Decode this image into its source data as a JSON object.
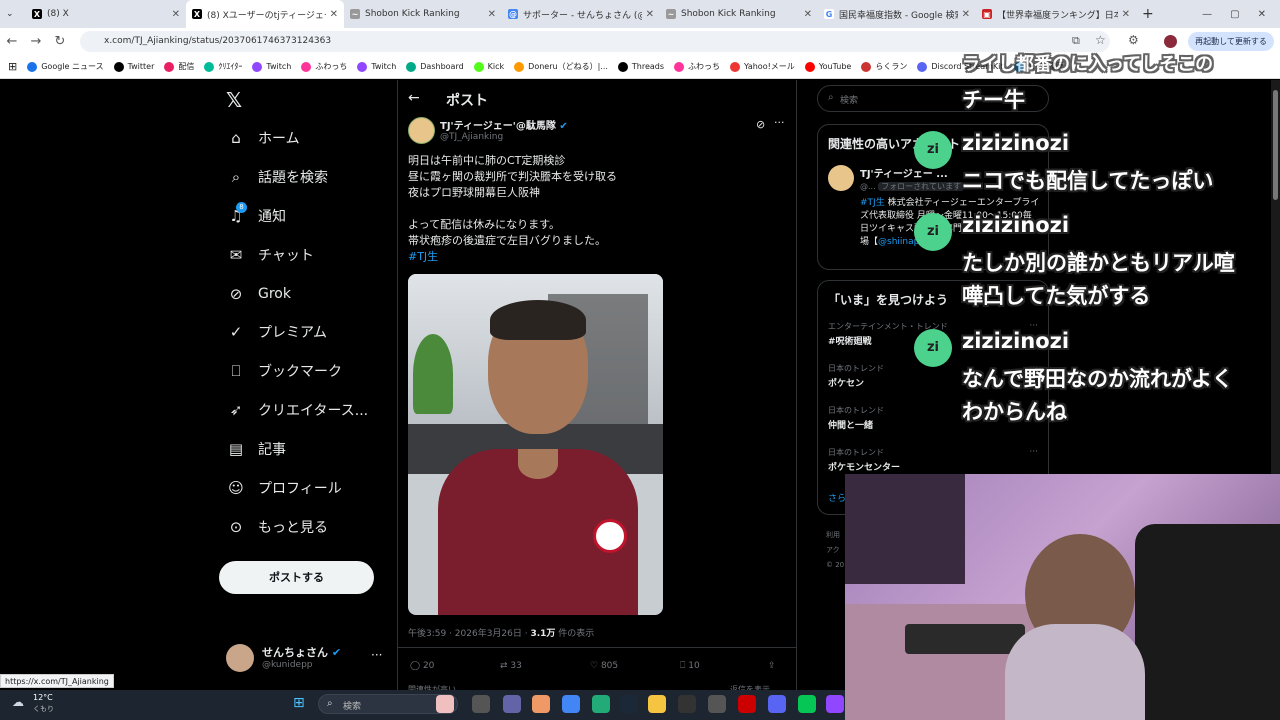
{
  "browser": {
    "tabs": [
      {
        "title": "(8) X",
        "fav": "X"
      },
      {
        "title": "(8) Xユーザーのtjティージェー'@駄馬",
        "fav": "X",
        "active": true
      },
      {
        "title": "Shobon Kick Ranking",
        "fav": "~"
      },
      {
        "title": "サポーター - せんちょさん (@kunide",
        "fav": "@"
      },
      {
        "title": "Shobon Kick Ranking",
        "fav": "~"
      },
      {
        "title": "国民幸福度指数 - Google 検索",
        "fav": "G"
      },
      {
        "title": "【世界幸福度ランキング】日本の幸",
        "fav": "▣"
      }
    ],
    "new_tab": "+",
    "url": "x.com/TJ_Ajianking/status/2037061746373124363",
    "resume_button": "再起動して更新する",
    "bookmarks": [
      "Google ニュース",
      "Twitter",
      "配信",
      "ｸﾘｴｲﾀｰ",
      "Twitch",
      "ふわっち",
      "Twitch",
      "Dashboard",
      "Kick",
      "Doneru（どねる）|...",
      "Threads",
      "ふわっち",
      "Yahoo!メール",
      "YouTube",
      "らくラン",
      "Discord StreamKit",
      "ﾂｲｯﾀｰ履歴"
    ]
  },
  "x": {
    "nav": [
      {
        "label": "ホーム",
        "icon": "home-icon"
      },
      {
        "label": "話題を検索",
        "icon": "search-icon"
      },
      {
        "label": "通知",
        "icon": "bell-icon",
        "badge": "8"
      },
      {
        "label": "チャット",
        "icon": "mail-icon"
      },
      {
        "label": "Grok",
        "icon": "grok-icon"
      },
      {
        "label": "プレミアム",
        "icon": "verified-icon"
      },
      {
        "label": "ブックマーク",
        "icon": "bookmark-icon"
      },
      {
        "label": "クリエイタース...",
        "icon": "rocket-icon"
      },
      {
        "label": "記事",
        "icon": "article-icon"
      },
      {
        "label": "プロフィール",
        "icon": "person-icon"
      },
      {
        "label": "もっと見る",
        "icon": "more-icon"
      }
    ],
    "post_button": "ポストする",
    "account": {
      "name": "せんちょさん",
      "handle": "@kunidepp"
    },
    "header_title": "ポスト",
    "post": {
      "author": "TJ'ティージェー'@駄馬隊",
      "handle": "@TJ_Ajianking",
      "lines": [
        "明日は午前中に肺のCT定期検診",
        "昼に霞ヶ関の裁判所で判決謄本を受け取る",
        "夜はプロ野球開幕巨人阪神",
        "",
        "よって配信は休みになります。",
        "帯状疱疹の後遺症で左目バグりました。"
      ],
      "hashtag": "#TJ生",
      "timestamp": "午後3:59 · 2026年3月26日 · ",
      "views_value": "3.1万",
      "views_label": " 件の表示",
      "replies": "20",
      "reposts": "33",
      "likes": "805",
      "bookmarks": "10",
      "below1": "関連性が高い",
      "below2": "返信を表示"
    },
    "search_placeholder": "検索",
    "related": {
      "title": "関連性の高いアカウント",
      "name": "TJ'ティージェー ...",
      "handle": "@...",
      "follows_you": "フォローされています",
      "bio_tag": "#TJ生",
      "bio": "株式会社ティージェーエンタープライズ代表取締役 月曜〜金曜11:00〜15:00毎日ツイキャス配信 カ専門店【",
      "bio_link": "@",
      "bio_end": "osu】 野球場【",
      "bio_handle": "@shiinapro",
      "bio_close": "】"
    },
    "trends": {
      "title": "「いま」を見つけよう",
      "items": [
        {
          "cat": "エンターテインメント・トレンド",
          "name": "#呪術廻戦"
        },
        {
          "cat": "日本のトレンド",
          "name": "ポケセン"
        },
        {
          "cat": "日本のトレンド",
          "name": "仲間と一緒"
        },
        {
          "cat": "日本のトレンド",
          "name": "ポケモンセンター"
        }
      ],
      "more": "さら"
    },
    "footer": [
      "利用",
      "アク",
      "© 20"
    ]
  },
  "status_url": "https://x.com/TJ_Ajianking",
  "chat": {
    "top_partial": "ライし都番のに入ってしそこの",
    "top_line2": "チー牛",
    "messages": [
      {
        "av": "zi",
        "user": "zizizinozi",
        "text": [
          "ニコでも配信してたっぽい"
        ]
      },
      {
        "av": "zi",
        "user": "zizizinozi",
        "text": [
          "たしか別の誰かともリアル喧",
          "嘩凸してた気がする"
        ]
      },
      {
        "av": "zi",
        "user": "zizizinozi",
        "text": [
          "なんで野田なのか流れがよく",
          "わからんね"
        ]
      }
    ]
  },
  "taskbar": {
    "weather_temp": "12°C",
    "weather_desc": "くもり",
    "search": "検索"
  }
}
